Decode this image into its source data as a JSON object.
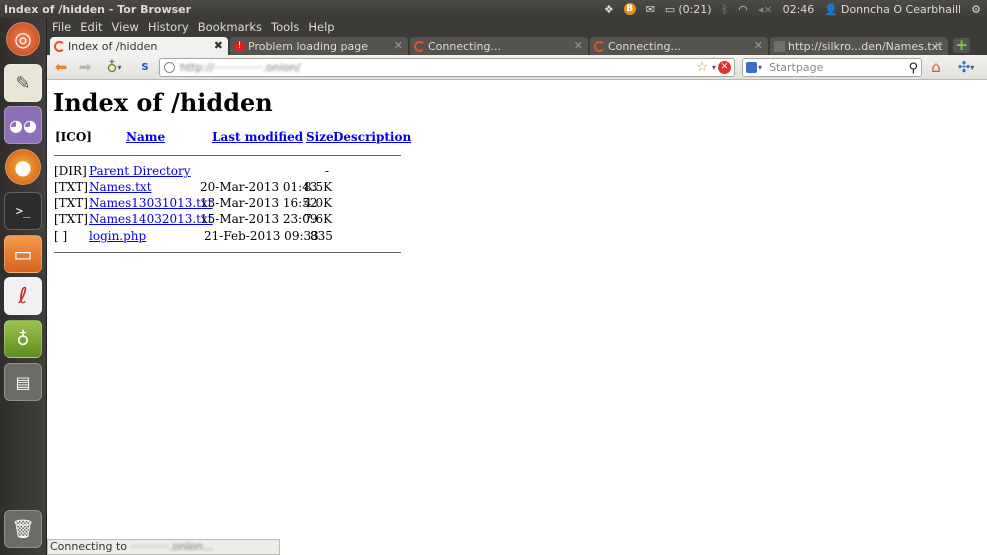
{
  "window": {
    "title": "Index of /hidden - Tor Browser"
  },
  "panel": {
    "battery": "(0:21)",
    "time": "02:46",
    "user": "Donncha O Cearbhaill"
  },
  "menu": [
    "File",
    "Edit",
    "View",
    "History",
    "Bookmarks",
    "Tools",
    "Help"
  ],
  "tabs": [
    {
      "label": "Index of /hidden",
      "active": true,
      "icon": "loading-spinner-icon"
    },
    {
      "label": "Problem loading page",
      "active": false,
      "icon": "error-icon"
    },
    {
      "label": "Connecting...",
      "active": false,
      "icon": "loading-spinner-icon"
    },
    {
      "label": "Connecting...",
      "active": false,
      "icon": "loading-spinner-icon"
    },
    {
      "label": "http://silkro...den/Names.txt",
      "active": false,
      "icon": "blank-page-icon"
    }
  ],
  "navbar": {
    "url": "http://··············.onion/",
    "search_placeholder": "Startpage"
  },
  "page": {
    "heading": "Index of /hidden",
    "columns": {
      "icon": "[ICO]",
      "name": "Name",
      "modified": "Last modified",
      "size": "Size",
      "description": "Description"
    },
    "rows": [
      {
        "type": "[DIR]",
        "name": "Parent Directory",
        "modified": "",
        "size": "-"
      },
      {
        "type": "[TXT]",
        "name": "Names.txt",
        "modified": "20-Mar-2013 01:43",
        "size": "8.5K"
      },
      {
        "type": "[TXT]",
        "name": "Names13031013.txt",
        "modified": "13-Mar-2013 16:52",
        "size": "4.0K"
      },
      {
        "type": "[TXT]",
        "name": "Names14032013.txt",
        "modified": "15-Mar-2013 23:09",
        "size": "7.6K"
      },
      {
        "type": "[ ]",
        "name": "login.php",
        "modified": "21-Feb-2013 09:33",
        "size": "835"
      }
    ]
  },
  "status": {
    "prefix": "Connecting to",
    "host": "···········.onion..."
  }
}
